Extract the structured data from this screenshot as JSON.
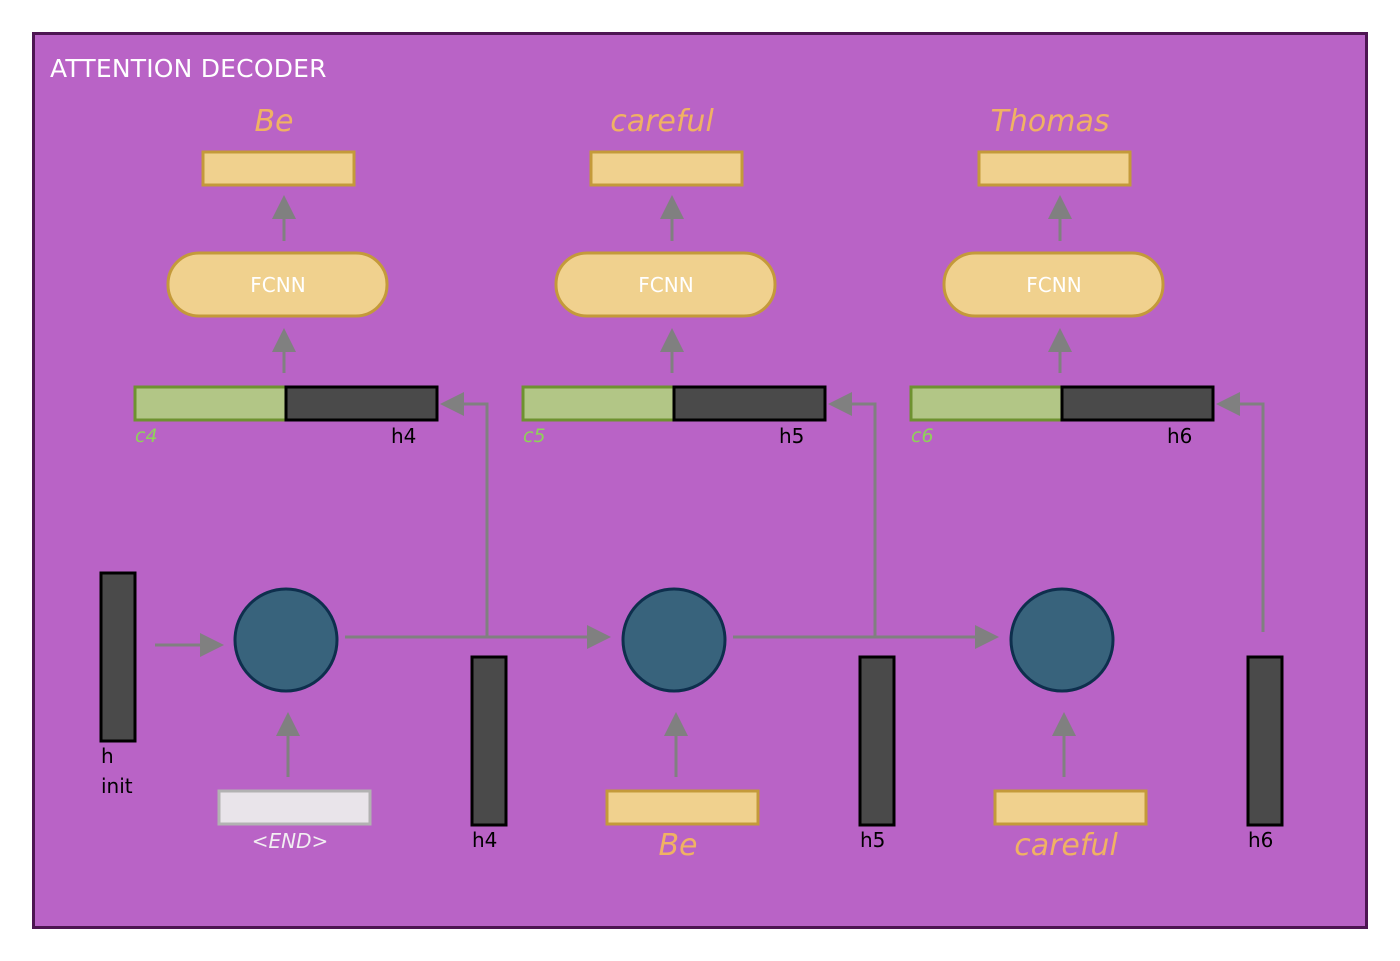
{
  "title": "ATTENTION DECODER",
  "colors": {
    "background": "#b963c6",
    "frame_border": "#4d1552",
    "word_text": "#f0b263",
    "output_box_fill": "#f0d18e",
    "output_box_stroke": "#c49a3a",
    "context_fill": "#b2c686",
    "context_stroke": "#6e9230",
    "context_label": "#8fd15a",
    "hidden_fill": "#4a4a4a",
    "hidden_stroke": "#000000",
    "cell_fill": "#38637c",
    "cell_stroke": "#0e2f4d",
    "arrow": "#808080",
    "end_token_fill": "#e9e4ea",
    "end_token_stroke": "#b2b2b2"
  },
  "steps": [
    {
      "output_word": "Be",
      "fcnn_label": "FCNN",
      "context_label": "c4",
      "hidden_label": "h4",
      "input_token": "<END>",
      "input_is_end": true,
      "state_out_label": "h4"
    },
    {
      "output_word": "careful",
      "fcnn_label": "FCNN",
      "context_label": "c5",
      "hidden_label": "h5",
      "input_token": "Be",
      "input_is_end": false,
      "state_out_label": "h5"
    },
    {
      "output_word": "Thomas",
      "fcnn_label": "FCNN",
      "context_label": "c6",
      "hidden_label": "h6",
      "input_token": "careful",
      "input_is_end": false,
      "state_out_label": "h6"
    }
  ],
  "initial_state": {
    "label_line1": "h",
    "label_line2": "init"
  }
}
